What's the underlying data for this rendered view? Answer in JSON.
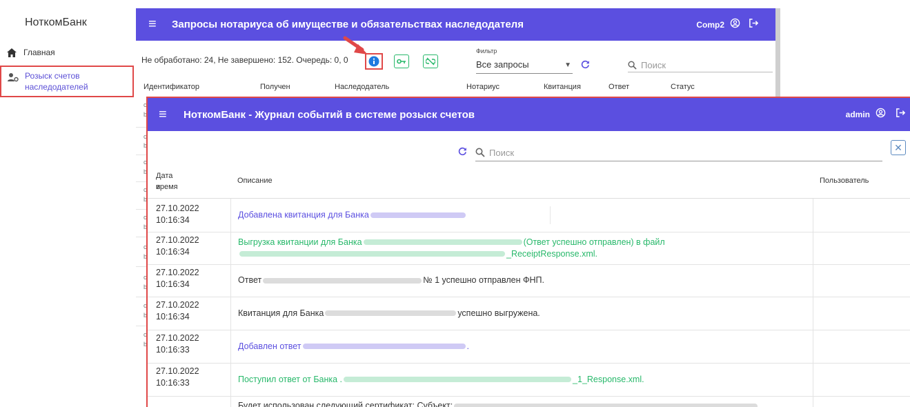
{
  "app": {
    "brand": "НоткомБанк"
  },
  "nav": {
    "home_label": "Главная",
    "search_label_line1": "Розыск счетов",
    "search_label_line2": "наследодателей"
  },
  "background_window": {
    "title": "Запросы нотариуса об имуществе и обязательствах наследодателя",
    "user": "Comp2",
    "status": "Не обработано: 24, Не завершено: 152. Очередь: 0, 0",
    "filter_label": "Фильтр",
    "filter_value": "Все запросы",
    "search_placeholder": "Поиск",
    "columns": [
      "Идентификатор",
      "Получен",
      "Наследодатель",
      "Нотариус",
      "Квитанция",
      "Ответ",
      "Статус"
    ],
    "row_stubs": [
      "c",
      "b",
      "c",
      "b",
      "c",
      "b",
      "c",
      "b",
      "c",
      "b",
      "c",
      "b",
      "c",
      "b",
      "c",
      "b"
    ]
  },
  "dialog": {
    "title": "НоткомБанк - Журнал событий в системе розыск счетов",
    "user": "admin",
    "search_placeholder": "Поиск",
    "columns": {
      "datetime_line1": "Дата и",
      "datetime_line2": "время",
      "description": "Описание",
      "user": "Пользователь"
    },
    "rows": [
      {
        "date": "27.10.2022",
        "time": "10:16:34",
        "color": "purple",
        "line1_a": "Добавлена квитанция для Банка",
        "line1_b": "",
        "line2_b": ""
      },
      {
        "date": "27.10.2022",
        "time": "10:16:34",
        "color": "green",
        "line1_a": "Выгрузка квитанции для Банка",
        "line1_b": "(Ответ успешно отправлен) в файл",
        "line2_b": "_ReceiptResponse.xml."
      },
      {
        "date": "27.10.2022",
        "time": "10:16:34",
        "color": "dark",
        "line1_a": "Ответ",
        "line1_b": "№ 1 успешно отправлен ФНП.",
        "line2_b": ""
      },
      {
        "date": "27.10.2022",
        "time": "10:16:34",
        "color": "dark",
        "line1_a": "Квитанция для Банка",
        "line1_b": "успешно выгружена.",
        "line2_b": ""
      },
      {
        "date": "27.10.2022",
        "time": "10:16:33",
        "color": "purple",
        "line1_a": "Добавлен ответ",
        "line1_b": ".",
        "line2_b": ""
      },
      {
        "date": "27.10.2022",
        "time": "10:16:33",
        "color": "green",
        "line1_a": "Поступил ответ от Банка .",
        "line1_b": "_1_Response.xml.",
        "line2_b": ""
      },
      {
        "date": "",
        "time": "",
        "color": "dark",
        "line1_a": "Будет использован следующий сертификат: Субъект:",
        "line1_b": "",
        "line2_b": ""
      }
    ]
  },
  "colors": {
    "header": "#5b4fe0",
    "accent_green": "#27b86a",
    "highlight_red": "#e04848",
    "link_purple": "#5b4fe0"
  }
}
